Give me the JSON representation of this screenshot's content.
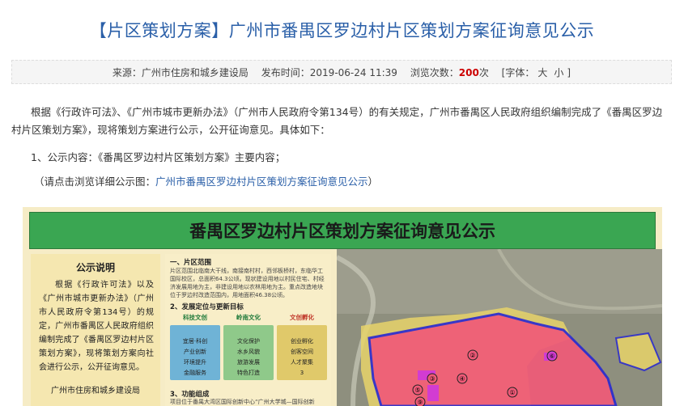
{
  "page_title": "【片区策划方案】广州市番禺区罗边村片区策划方案征询意见公示",
  "meta": {
    "source_label": "来源：",
    "source_value": "广州市住房和城乡建设局",
    "date_label": "发布时间：",
    "date_value": "2019-06-24 11:39",
    "views_label": "浏览次数：",
    "views_value": "200",
    "views_unit": "次",
    "font_prefix": "[字体：",
    "font_large": "大",
    "font_small": "小",
    "font_suffix": "]"
  },
  "body": {
    "para1": "根据《行政许可法》、《广州市城市更新办法》（广州市人民政府令第134号）的有关规定，广州市番禺区人民政府组织编制完成了《番禺区罗边村片区策划方案》，现将策划方案进行公示，公开征询意见。具体如下：",
    "para2": "1、公示内容：《番禺区罗边村片区策划方案》主要内容；",
    "para3_prefix": "（请点击浏览详细公示图：",
    "para3_link": "广州市番禺区罗边村片区策划方案征询意见公示",
    "para3_suffix": "）"
  },
  "poster": {
    "title": "番禺区罗边村片区策划方案征询意见公示",
    "notice_title": "公示说明",
    "notice_body": "根据《行政许可法》以及《广州市城市更新办法》（广州市人民政府令第134号）的规定，广州市番禺区人民政府组织编制完成了《番禺区罗边村片区策划方案》，现将策划方案向社会进行公示，公开征询意见。",
    "notice_sign": "广州市住房和城乡建设局",
    "section1": "一、片区范围",
    "section1_text": "片区范围北临南大干线，南接南村村，西邻板桥村，东临华工国际校区，总面积64.3公顷。现状建设用地以村民住宅、村经济发展用地为主，非建设用地以农林用地为主。重点改造地块位于罗边村改造范围内，用地面积46.38公顷。",
    "section2": "2、发展定位与更新目标",
    "goal_heads": [
      "科技文创",
      "岭南文化",
      "文创孵化"
    ],
    "goal_bodies": [
      "宜居·科创\n产业创新\n环境提升\n金融服务",
      "文化保护\n水乡风貌\n旅游发展\n特色打造",
      "创业孵化\n创客空间\n人才聚集\n3"
    ],
    "section3": "3、功能组成",
    "section3_text": "项目位于番禺大湾区国际创新中心“广州大学城—国际创新城”，番禺区在文创产业中的地位。",
    "map_labels": [
      "②",
      "③",
      "④",
      "⑤",
      "⑥",
      "①",
      "⑨"
    ],
    "colors": {
      "title_blue": "#2a5fa8",
      "views_red": "#cc0000",
      "poster_green": "#3aa652",
      "zone_pink": "#f05a78",
      "zone_yellow": "#e8d46a",
      "boundary_blue": "#2b2bd0",
      "marker_magenta": "#d23cd2"
    }
  }
}
